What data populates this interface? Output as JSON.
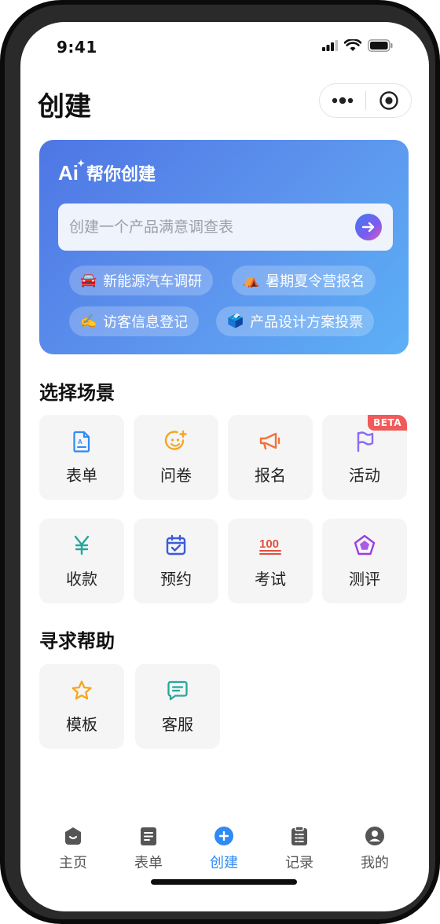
{
  "status_bar": {
    "time": "9:41"
  },
  "header": {
    "title": "创建"
  },
  "ai_card": {
    "logo": "Ai",
    "title": "帮你创建",
    "input_placeholder": "创建一个产品满意调查表",
    "chips": [
      {
        "emoji": "🚘",
        "label": "新能源汽车调研"
      },
      {
        "emoji": "⛺",
        "label": "暑期夏令营报名"
      },
      {
        "emoji": "✍️",
        "label": "访客信息登记"
      },
      {
        "emoji": "🗳️",
        "label": "产品设计方案投票"
      }
    ]
  },
  "scenes": {
    "title": "选择场景",
    "items": [
      {
        "label": "表单",
        "icon": "form-doc-icon",
        "color": "#2f8af5"
      },
      {
        "label": "问卷",
        "icon": "smile-plus-icon",
        "color": "#f5a623"
      },
      {
        "label": "报名",
        "icon": "megaphone-icon",
        "color": "#f2723a"
      },
      {
        "label": "活动",
        "icon": "flag-icon",
        "color": "#8a6cf0",
        "badge": "BETA"
      },
      {
        "label": "收款",
        "icon": "yen-icon",
        "color": "#27a79a"
      },
      {
        "label": "预约",
        "icon": "calendar-check-icon",
        "color": "#3a5bd9"
      },
      {
        "label": "考试",
        "icon": "score-100-icon",
        "color": "#e2503d"
      },
      {
        "label": "测评",
        "icon": "radar-icon",
        "color": "#9b3fe0"
      }
    ]
  },
  "help": {
    "title": "寻求帮助",
    "items": [
      {
        "label": "模板",
        "icon": "star-icon",
        "color": "#f5a623"
      },
      {
        "label": "客服",
        "icon": "chat-icon",
        "color": "#27a79a"
      }
    ]
  },
  "tabbar": {
    "items": [
      {
        "label": "主页",
        "icon": "home-icon"
      },
      {
        "label": "表单",
        "icon": "form-icon"
      },
      {
        "label": "创建",
        "icon": "create-plus-icon",
        "active": true
      },
      {
        "label": "记录",
        "icon": "clipboard-icon"
      },
      {
        "label": "我的",
        "icon": "profile-icon"
      }
    ],
    "active_color": "#2f8af5"
  }
}
